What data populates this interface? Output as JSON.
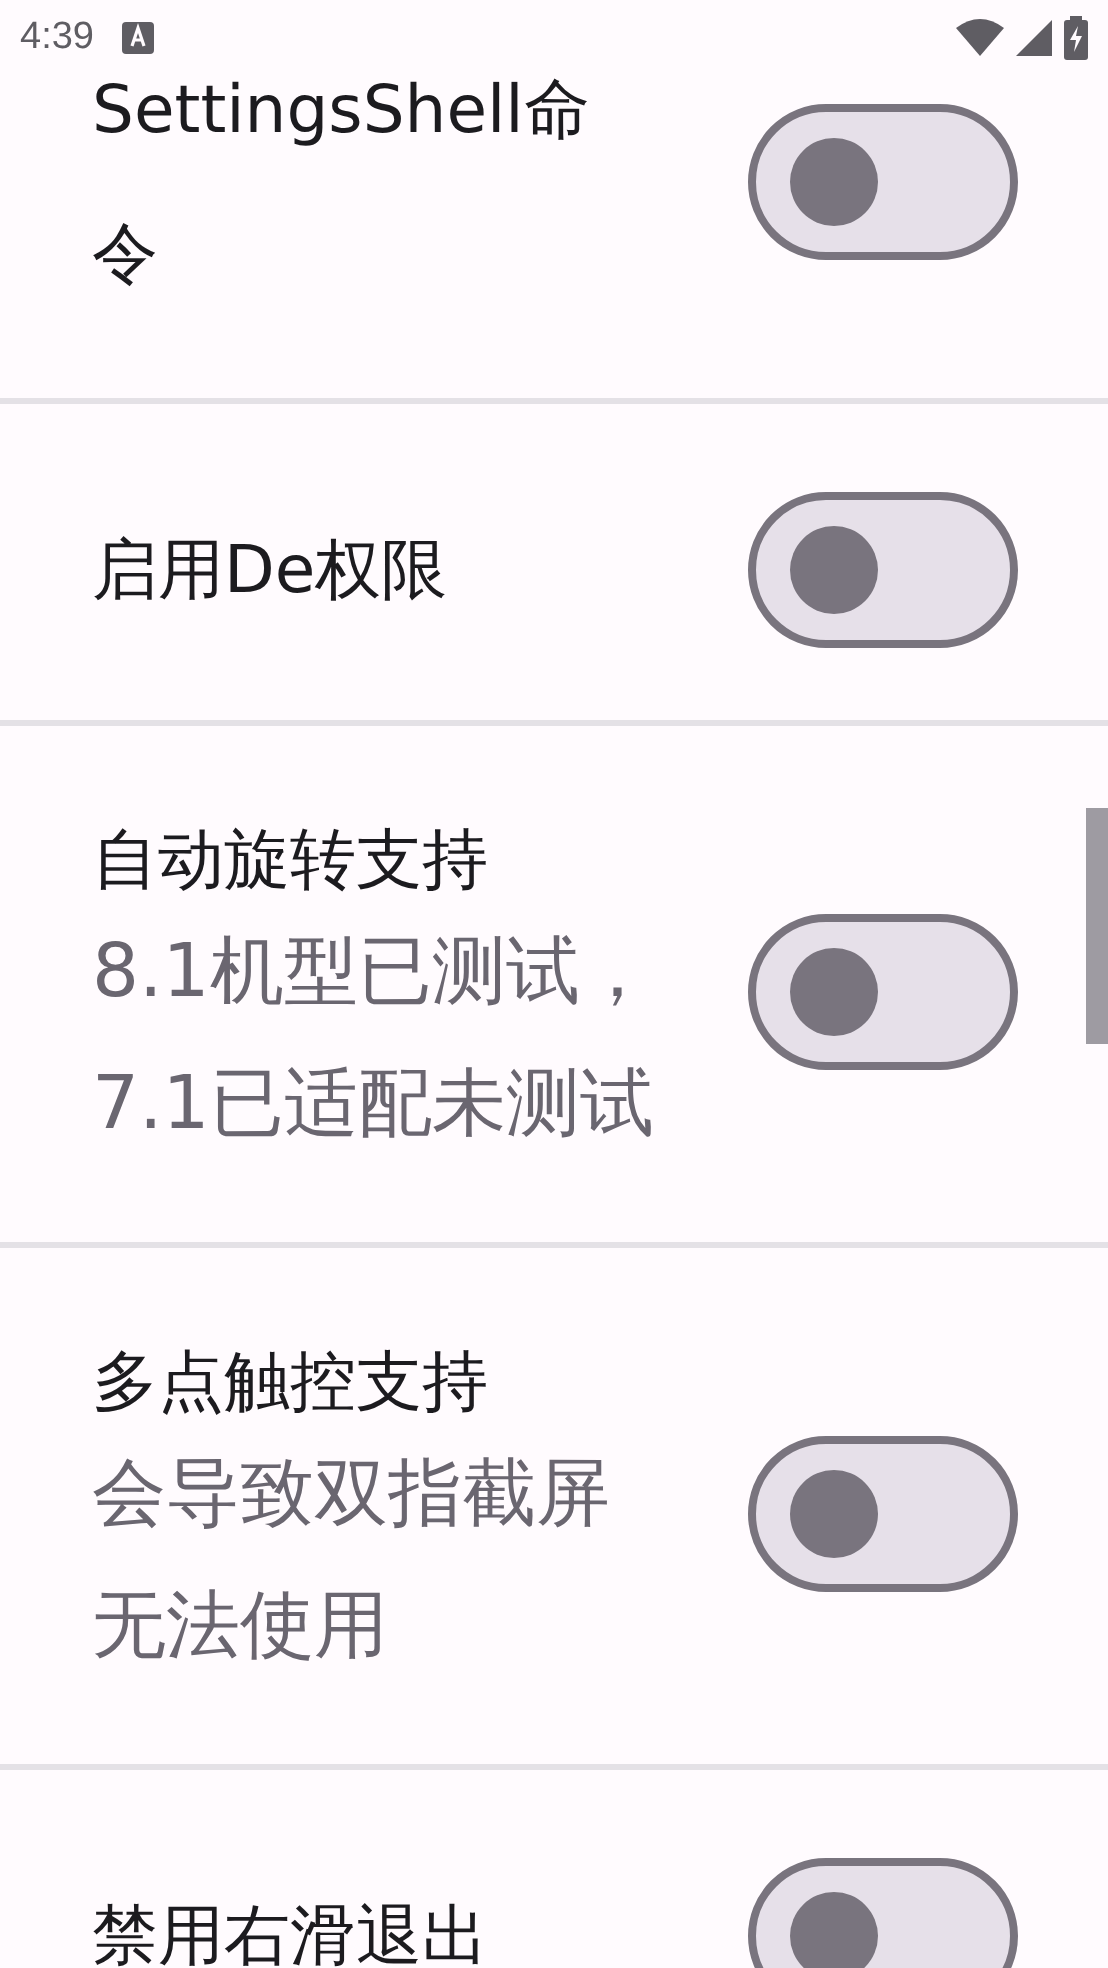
{
  "status_bar": {
    "time": "4:39"
  },
  "settings": [
    {
      "title": "SettingsShell命令",
      "checked": false
    },
    {
      "title": "启用De权限",
      "checked": false
    },
    {
      "title": "自动旋转支持",
      "subtitle": "8.1机型已测试，7.1已适配未测试",
      "checked": false
    },
    {
      "title": "多点触控支持",
      "subtitle": "会导致双指截屏无法使用",
      "checked": false
    },
    {
      "title": "禁用右滑退出",
      "checked": false
    }
  ]
}
